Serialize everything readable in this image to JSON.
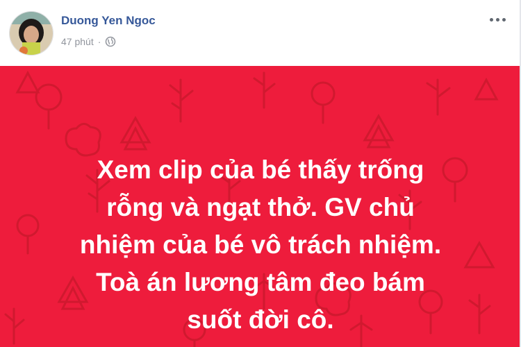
{
  "post": {
    "author_name": "Duong Yen Ngoc",
    "timestamp": "47 phút",
    "separator": "·",
    "privacy_icon": "globe-icon",
    "more_icon": "more-options-icon",
    "status_text": "Xem clip của bé thấy trống\nrỗng và ngạt thở. GV chủ\nnhiệm của bé vô trách nhiệm.\nToà án lương tâm đeo bám\nsuốt đời cô.",
    "background_color": "#ee1c3c",
    "text_color": "#ffffff",
    "author_color": "#365899"
  }
}
